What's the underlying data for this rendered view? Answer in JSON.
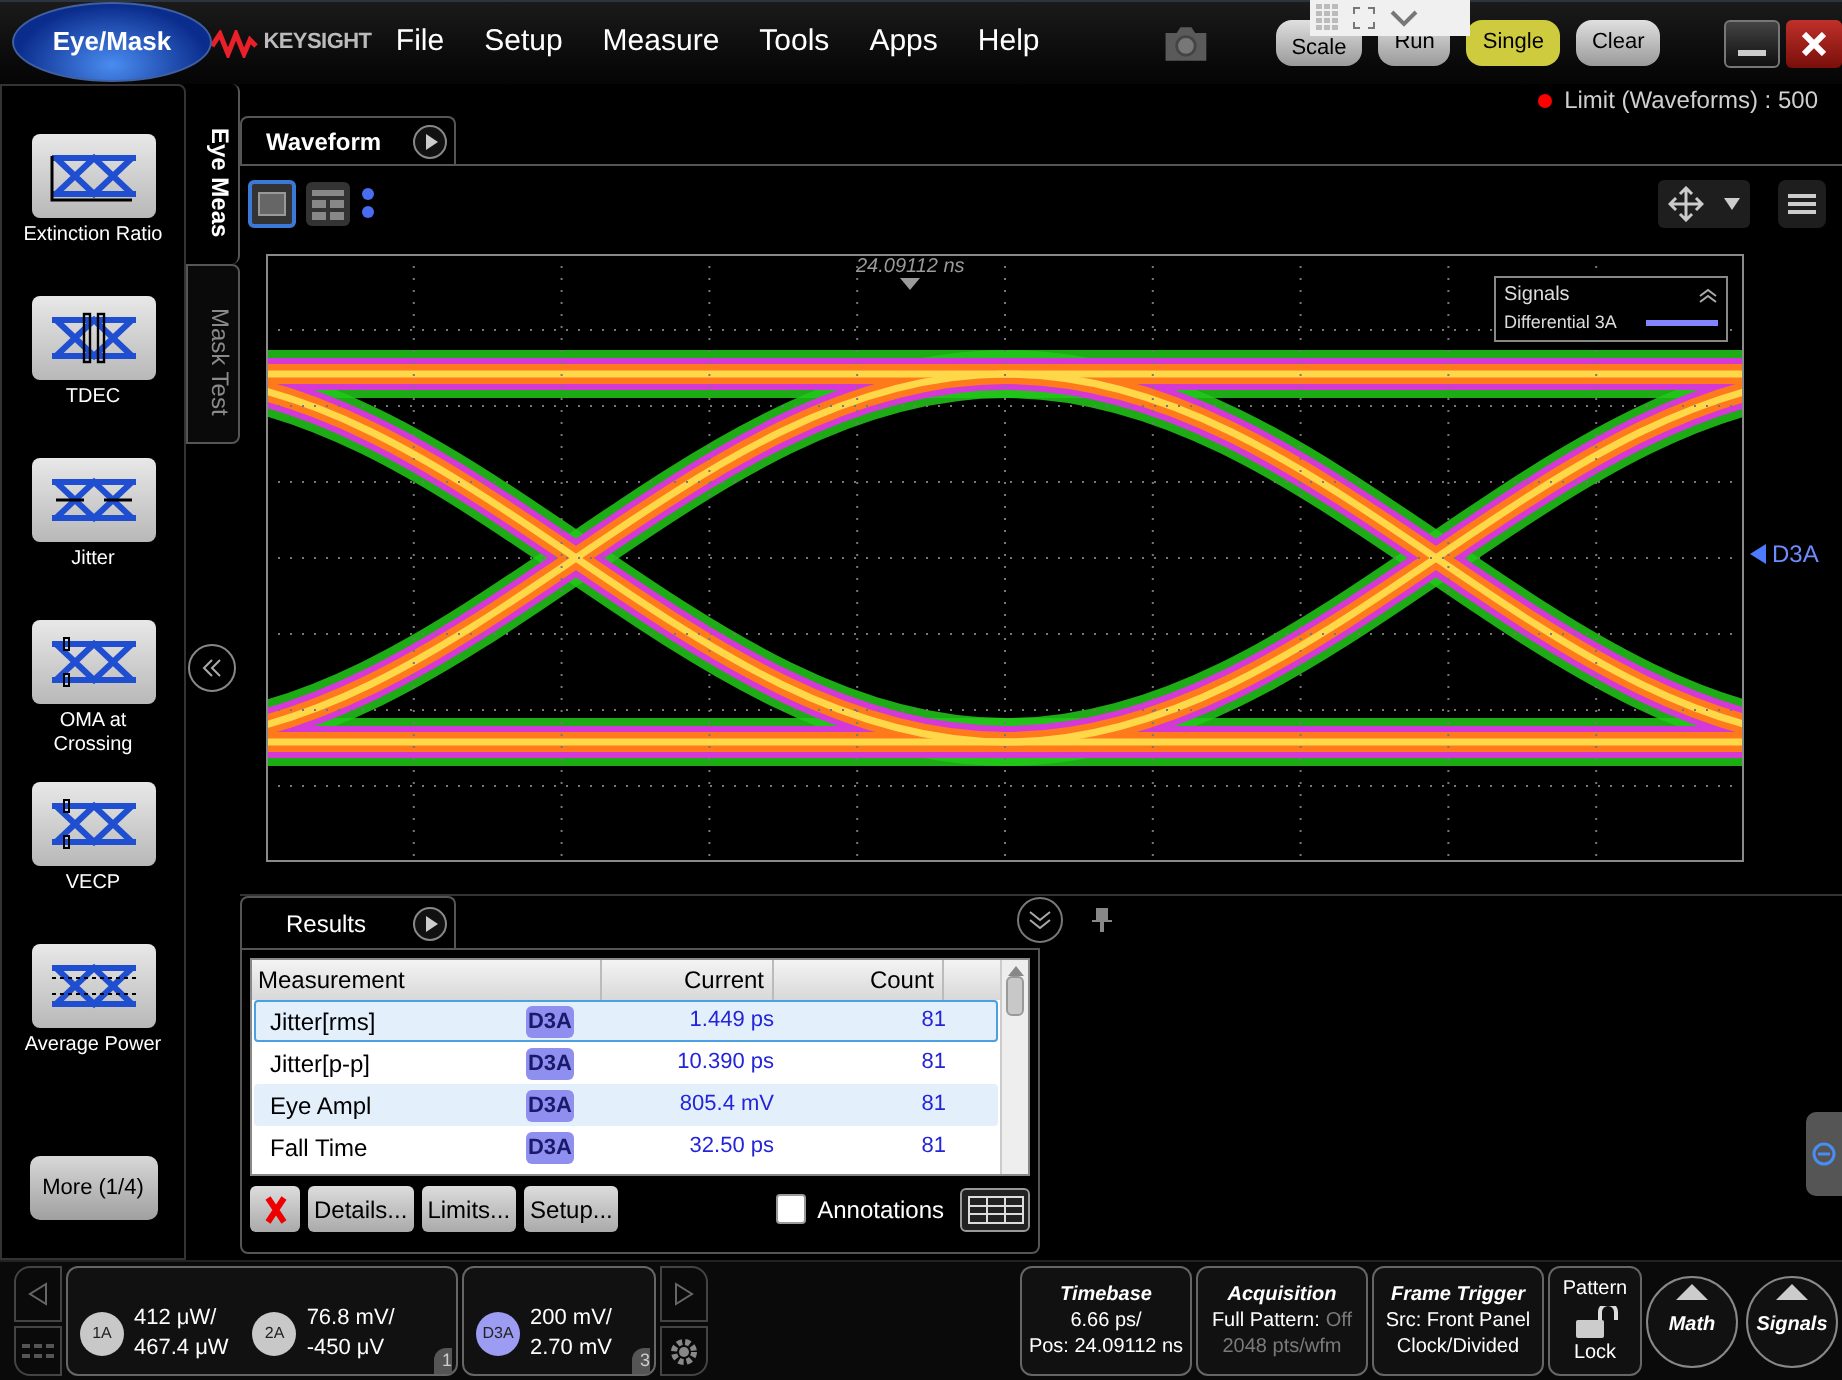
{
  "app_button": {
    "label": "Eye/Mask"
  },
  "brand": "KEYSIGHT",
  "menu": [
    "File",
    "Setup",
    "Measure",
    "Tools",
    "Apps",
    "Help"
  ],
  "toolbar_buttons": [
    {
      "label": "Scale",
      "selected": false
    },
    {
      "label": "Run",
      "selected": false
    },
    {
      "label": "Single",
      "selected": true
    },
    {
      "label": "Clear",
      "selected": false
    }
  ],
  "limit_status": "Limit (Waveforms) : 500",
  "side_tabs": [
    {
      "label": "Eye Meas",
      "selected": true
    },
    {
      "label": "Mask Test",
      "selected": false
    }
  ],
  "measure_tools": [
    "Extinction Ratio",
    "TDEC",
    "Jitter",
    "OMA at Crossing",
    "VECP",
    "Average Power"
  ],
  "more_button": "More (1/4)",
  "waveform_tab": "Waveform",
  "plot": {
    "time_marker": "24.09112 ns",
    "legend_title": "Signals",
    "legend_items": [
      {
        "label": "Differential 3A",
        "color": "#8484ff"
      }
    ],
    "channel_marker": "D3A"
  },
  "results": {
    "tab": "Results",
    "columns": [
      "Measurement",
      "Current",
      "Count"
    ],
    "rows": [
      {
        "measurement": "Jitter[rms]",
        "source": "D3A",
        "current": "1.449 ps",
        "count": "81",
        "selected": true
      },
      {
        "measurement": "Jitter[p-p]",
        "source": "D3A",
        "current": "10.390 ps",
        "count": "81",
        "selected": false
      },
      {
        "measurement": "Eye Ampl",
        "source": "D3A",
        "current": "805.4 mV",
        "count": "81",
        "selected": false
      },
      {
        "measurement": "Fall Time",
        "source": "D3A",
        "current": "32.50 ps",
        "count": "81",
        "selected": false
      }
    ],
    "buttons": [
      "Details...",
      "Limits...",
      "Setup..."
    ],
    "annotations": {
      "label": "Annotations",
      "checked": false
    }
  },
  "channel_groups": [
    {
      "number": "1",
      "channels": [
        {
          "badge": "1A",
          "color": "#c8c8c8",
          "scale": "412 μW/",
          "offset": "467.4 μW"
        },
        {
          "badge": "2A",
          "color": "#c8c8c8",
          "scale": "76.8 mV/",
          "offset": "-450 μV"
        }
      ]
    },
    {
      "number": "3",
      "channels": [
        {
          "badge": "D3A",
          "color": "#9c9cf2",
          "scale": "200 mV/",
          "offset": "2.70 mV"
        }
      ]
    }
  ],
  "status_panels": [
    {
      "title": "Timebase",
      "lines": [
        [
          {
            "text": "6.66 ps/",
            "dim": false
          }
        ],
        [
          {
            "text": "Pos: 24.09112 ns",
            "dim": false
          }
        ]
      ]
    },
    {
      "title": "Acquisition",
      "lines": [
        [
          {
            "text": "Full Pattern:",
            "dim": false
          },
          {
            "text": "Off",
            "dim": true
          }
        ],
        [
          {
            "text": "2048 pts/wfm",
            "dim": true
          }
        ]
      ]
    },
    {
      "title": "Frame Trigger",
      "lines": [
        [
          {
            "text": "Src: Front Panel",
            "dim": false
          }
        ],
        [
          {
            "text": "Clock/Divided",
            "dim": false
          }
        ]
      ]
    }
  ],
  "pattern_lock": {
    "top": "Pattern",
    "bottom": "Lock"
  },
  "round_buttons": [
    "Math",
    "Signals"
  ]
}
